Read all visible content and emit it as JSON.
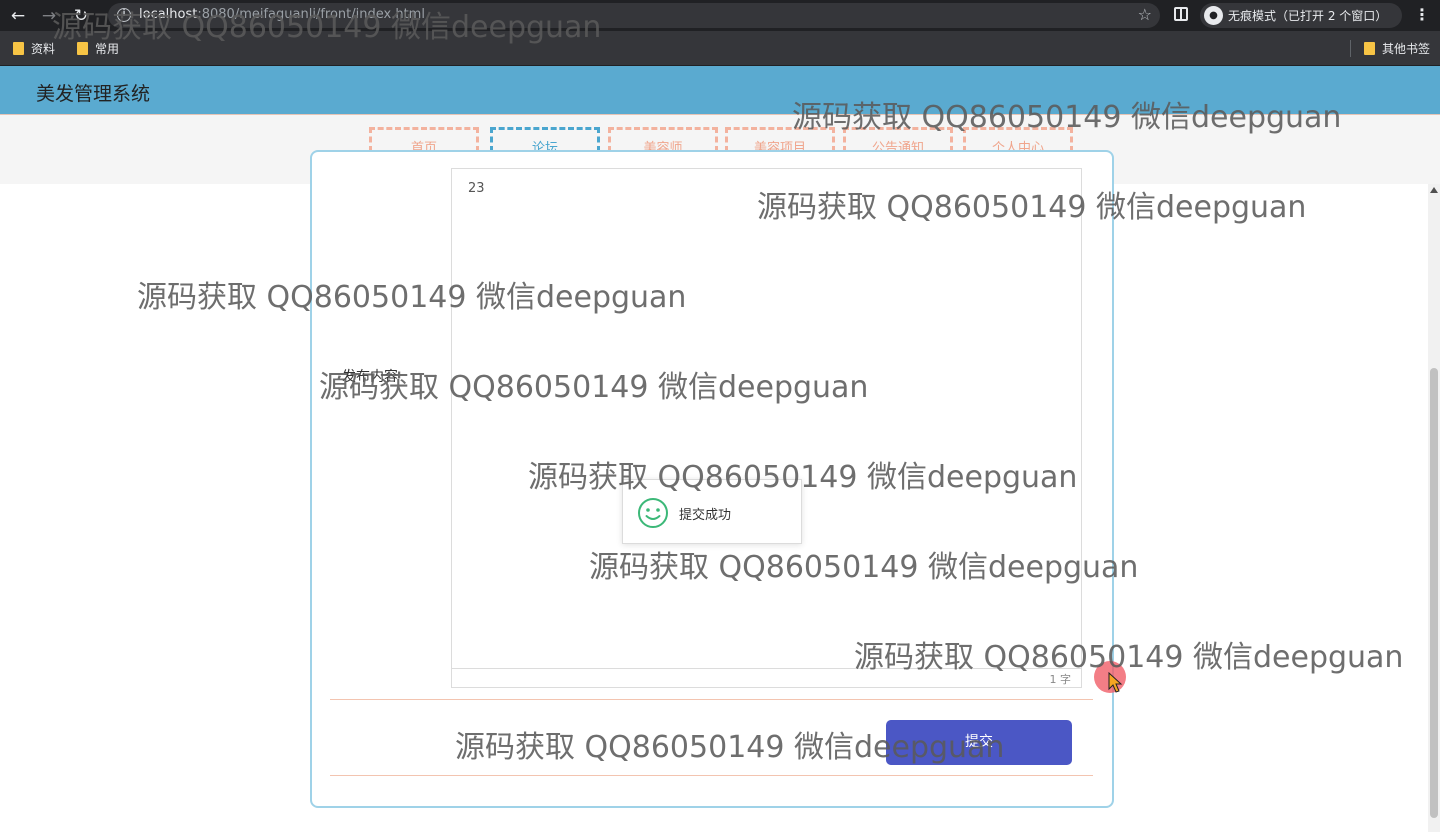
{
  "browser": {
    "url_host": "localhost",
    "url_rest": ":8080/meifaguanli/front/index.html",
    "incognito_label": "无痕模式（已打开 2 个窗口）",
    "bookmarks": [
      "资料",
      "常用"
    ],
    "other_bookmarks": "其他书签"
  },
  "header": {
    "title": "美发管理系统"
  },
  "nav": {
    "items": [
      "首页",
      "论坛",
      "美容师",
      "美容项目",
      "公告通知",
      "个人中心"
    ],
    "active": "论坛"
  },
  "form": {
    "content_label": "发布内容",
    "editor_text": "23",
    "word_count": "1 字",
    "submit_label": "提交"
  },
  "toast": {
    "message": "提交成功"
  },
  "watermark_text": "源码获取 QQ86050149 微信deepguan",
  "colors": {
    "header_bg": "#5aaad0",
    "nav_accent": "#f3b29e",
    "nav_active": "#4aa6cf",
    "submit_bg": "#4b57c5",
    "toast_icon": "#3cb878"
  }
}
